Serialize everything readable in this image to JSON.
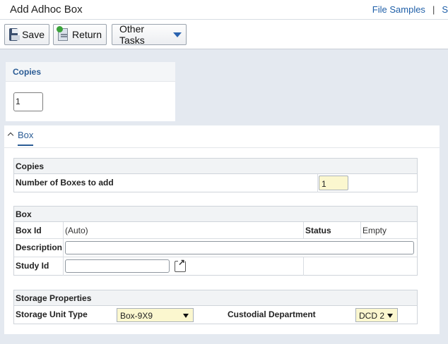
{
  "header": {
    "title": "Add Adhoc Box",
    "links": [
      "File Samples",
      "|",
      "S"
    ]
  },
  "toolbar": {
    "save_label": "Save",
    "return_label": "Return",
    "other_tasks_label": "Other Tasks"
  },
  "copies_card": {
    "title": "Copies",
    "value": "1"
  },
  "box_panel": {
    "tab_label": "Box",
    "copies_section": {
      "title": "Copies",
      "number_label": "Number of Boxes to add",
      "number_value": "1"
    },
    "box_section": {
      "title": "Box",
      "box_id_label": "Box Id",
      "box_id_value": "(Auto)",
      "status_label": "Status",
      "status_value": "Empty",
      "description_label": "Description",
      "description_value": "",
      "study_id_label": "Study Id",
      "study_id_value": ""
    },
    "storage_section": {
      "title": "Storage Properties",
      "unit_type_label": "Storage Unit Type",
      "unit_type_value": "Box-9X9",
      "custodial_label": "Custodial Department",
      "custodial_value": "DCD 2"
    }
  },
  "icons": [
    "save-icon",
    "return-icon",
    "caret-down-icon",
    "chevron-up-icon",
    "external-link-icon"
  ]
}
